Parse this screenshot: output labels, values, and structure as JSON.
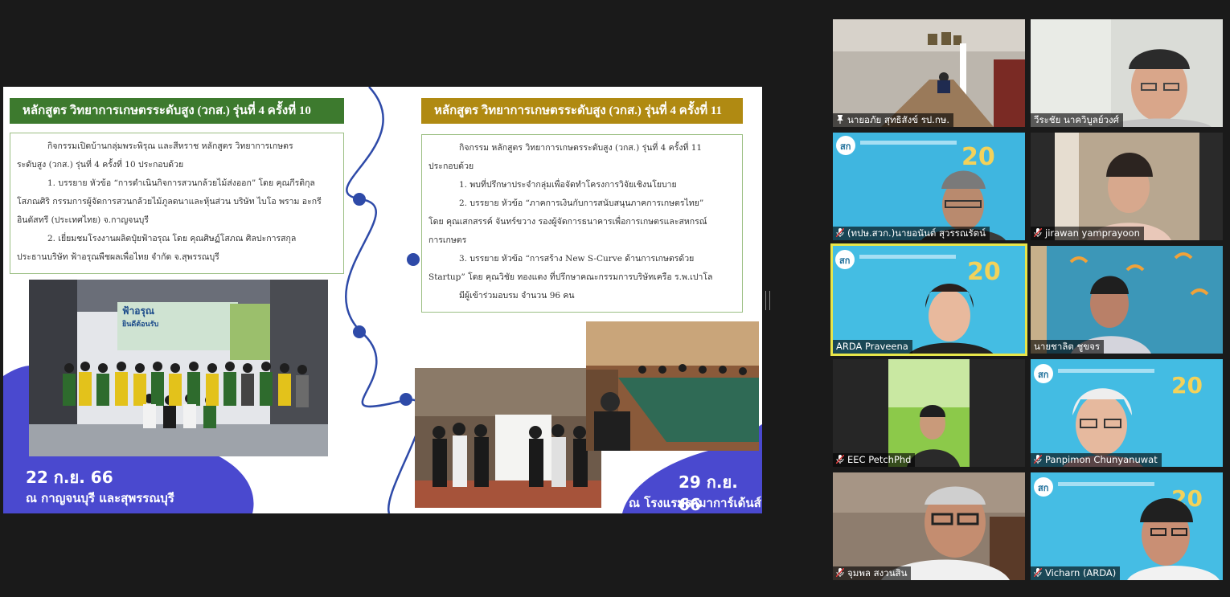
{
  "slide": {
    "left": {
      "title": "หลักสูตร วิทยาการเกษตรระดับสูง (วกส.) รุ่นที่ 4 ครั้งที่ 10",
      "lines": [
        "กิจกรรมเปิดบ้านกลุ่มพระพิรุณ และสีหราช หลักสูตร วิทยาการเกษตร",
        "ระดับสูง (วกส.) รุ่นที่ 4 ครั้งที่ 10 ประกอบด้วย",
        "1. บรรยาย หัวข้อ “การดำเนินกิจการสวนกล้วยไม้ส่งออก” โดย คุณกีรติกุล",
        "โสภณศิริ กรรมการผู้จัดการสวนกล้วยไม้ภูลดนาและหุ้นส่วน บริษัท ไบโอ พราม อะกรี",
        "อินดัสทรี (ประเทศไทย) จ.กาญจนบุรี",
        "2. เยี่ยมชมโรงงานผลิตปุ๋ยฟ้าอรุณ โดย คุณศิษฏ์โสภณ ศิลปะการสกุล",
        "ประธานบริษัท ฟ้าอรุณพืชผลเพื่อไทย จำกัด จ.สุพรรณบุรี"
      ],
      "banner_text": "ฟ้าอรุณ",
      "banner_sub": "ยินดีต้อนรับ",
      "date": "22 ก.ย. 66",
      "place": "ณ กาญจนบุรี และสุพรรณบุรี"
    },
    "right": {
      "title": "หลักสูตร วิทยาการเกษตรระดับสูง (วกส.) รุ่นที่ 4 ครั้งที่ 11",
      "lines": [
        "กิจกรรม หลักสูตร วิทยาการเกษตรระดับสูง (วกส.) รุ่นที่ 4 ครั้งที่ 11",
        "ประกอบด้วย",
        "1. พบที่ปรึกษาประจำกลุ่มเพื่อจัดทำโครงการวิจัยเชิงนโยบาย",
        "2. บรรยาย หัวข้อ “ภาคการเงินกับการสนับสนุนภาคการเกษตรไทย”",
        "โดย คุณเสกสรรค์ จันทร์ขวาง รองผู้จัดการธนาคารเพื่อการเกษตรและสหกรณ์",
        "การเกษตร",
        "3. บรรยาย หัวข้อ “การสร้าง New S-Curve ด้านการเกษตรด้วย",
        "Startup” โดย คุณวิชัย ทองแตง ที่ปรึกษาคณะกรรมการบริษัทเครือ ร.พ.เปาโล",
        "มีผู้เข้าร่วมอบรม จำนวน 96 คน"
      ],
      "date": "29 ก.ย. 66",
      "place": "ณ โรงแรมรามาการ์เด้นส์"
    }
  },
  "participants": [
    {
      "name": "นายอภัย สุทธิสังข์ รป.กษ.",
      "icon": "pin-icon",
      "bg": "#bcb6ad"
    },
    {
      "name": "วีระชัย นาควิบูลย์วงศ์",
      "icon": "",
      "bg": "#d9dcd8"
    },
    {
      "name": "(ทปษ.สวก.)นายอนันต์ สุวรรณรัตน์",
      "icon": "mic-muted-icon",
      "bg": "#3fb6e0"
    },
    {
      "name": "jirawan yamprayoon",
      "icon": "mic-muted-icon",
      "bg": "#b8a790"
    },
    {
      "name": "ARDA Praveena",
      "icon": "",
      "bg": "#44bde3"
    },
    {
      "name": "นายชาลิต ชูขจร",
      "icon": "",
      "bg": "#3c97b8"
    },
    {
      "name": "EEC PetchPhd",
      "icon": "mic-muted-icon",
      "bg": "#8cc94a"
    },
    {
      "name": "Panpimon Chunyanuwat",
      "icon": "mic-muted-icon",
      "bg": "#43bce3"
    },
    {
      "name": "จุมพล สงวนสิน",
      "icon": "mic-muted-icon",
      "bg": "#8e7d6e"
    },
    {
      "name": "Vicharn (ARDA)",
      "icon": "mic-muted-icon",
      "bg": "#45bde4"
    }
  ],
  "colors": {
    "active_speaker": "#e8e64a",
    "wave": "#2e4aa8",
    "title_green": "#3d7a2e",
    "title_gold": "#b08a12"
  }
}
